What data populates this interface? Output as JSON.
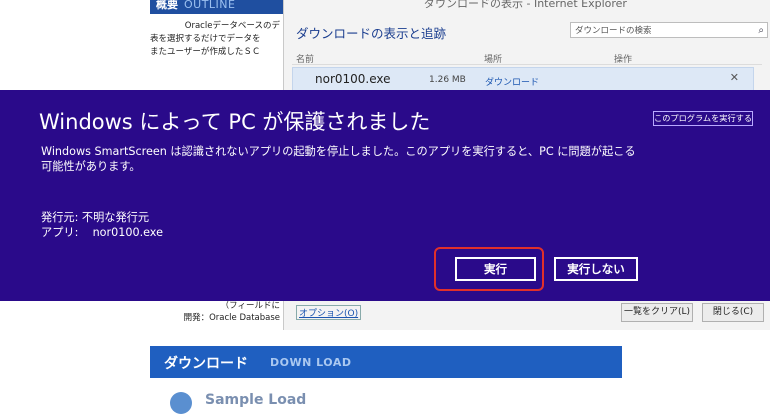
{
  "background_page": {
    "header_jp": "概要",
    "header_en": "OUTLINE",
    "intro_lines": [
      "Oracleデータベースのデ",
      "表を選択するだけでデータを",
      "またユーザーが作成したＳＣ"
    ],
    "lower_lines": [
      "（フィールドに",
      "開発：Oracle Database"
    ],
    "download_jp": "ダウンロード",
    "download_en": "DOWN LOAD",
    "sample_text": "Sample Load"
  },
  "ie_window": {
    "title": "ダウンロードの表示 - Internet Explorer",
    "heading": "ダウンロードの表示と追跡",
    "search_placeholder": "ダウンロードの検索",
    "columns": {
      "name": "名前",
      "location": "場所",
      "action": "操作"
    },
    "download_item": {
      "name": "nor0100.exe",
      "size": "1.26 MB",
      "location": "ダウンロード"
    },
    "options_link": "オプション(O)",
    "clear_button": "一覧をクリア(L)",
    "close_button": "閉じる(C)"
  },
  "smartscreen": {
    "title": "Windows によって PC が保護されました",
    "run_anyway_link": "このプログラムを実行する",
    "message_line1": "Windows SmartScreen は認識されないアプリの起動を停止しました。このアプリを実行すると、PC に問題が起こる",
    "message_line2": "可能性があります。",
    "publisher_label": "発行元:",
    "publisher_value": "不明な発行元",
    "app_label": "アプリ:",
    "app_value": "nor0100.exe",
    "run_button": "実行",
    "dont_run_button": "実行しない",
    "colors": {
      "dialog_bg": "#2a0a8a",
      "highlight": "#e0302a"
    }
  }
}
